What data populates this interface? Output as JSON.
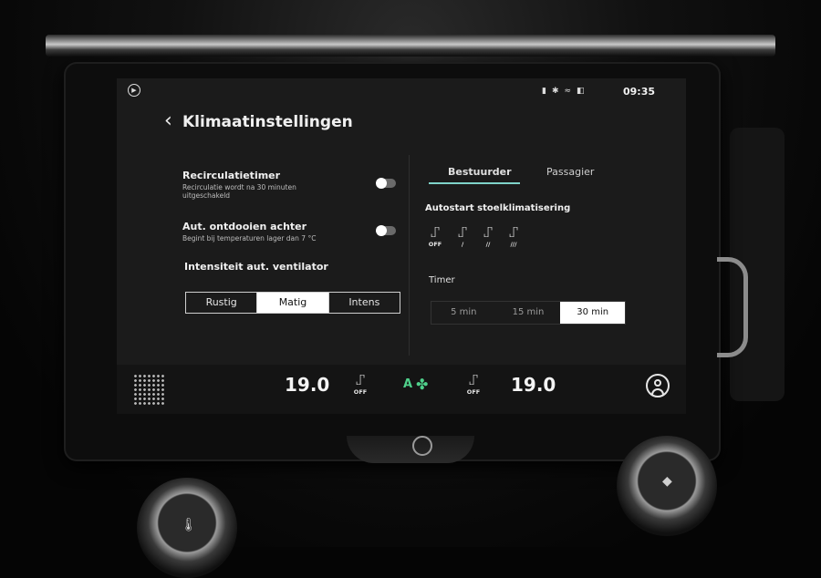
{
  "status": {
    "time": "09:35",
    "icons": [
      "signal-icon",
      "bluetooth-icon",
      "network-icon",
      "seat-status-icon"
    ]
  },
  "header": {
    "title": "Klimaatinstellingen"
  },
  "left": {
    "recirculation": {
      "label": "Recirculatietimer",
      "desc": "Recirculatie wordt na 30 minuten uitgeschakeld",
      "enabled": false
    },
    "defrost": {
      "label": "Aut. ontdooien achter",
      "desc": "Begint bij temperaturen lager dan 7 °C",
      "enabled": false
    },
    "intensity": {
      "label": "Intensiteit aut. ventilator",
      "options": [
        "Rustig",
        "Matig",
        "Intens"
      ],
      "selected": "Matig"
    }
  },
  "right": {
    "tabs": [
      "Bestuurder",
      "Passagier"
    ],
    "active_tab": "Bestuurder",
    "autostart_label": "Autostart stoelklimatisering",
    "seat_levels": [
      "OFF",
      "/",
      "//",
      "///"
    ],
    "timer_label": "Timer",
    "timer_options": [
      "5 min",
      "15 min",
      "30 min"
    ],
    "timer_selected": "30 min"
  },
  "climate": {
    "left_temp": "19.0",
    "right_temp": "19.0",
    "left_seat": "OFF",
    "right_seat": "OFF",
    "auto_label": "A"
  }
}
